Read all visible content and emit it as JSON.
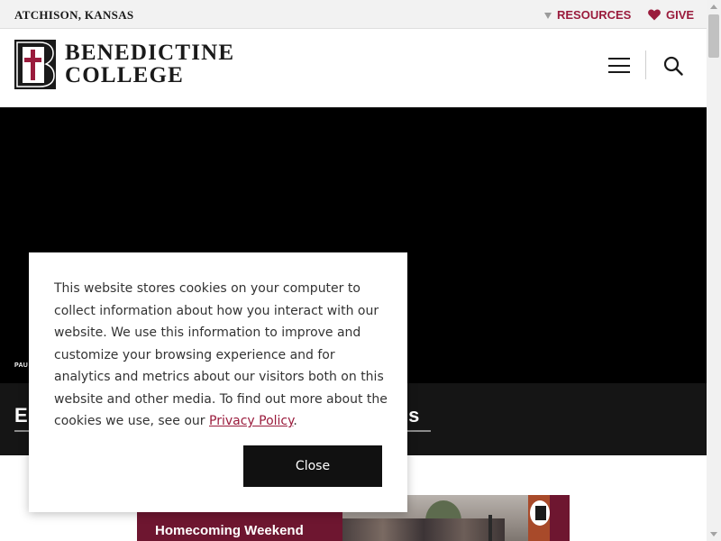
{
  "topbar": {
    "location": "ATCHISON, KANSAS",
    "resources_label": "RESOURCES",
    "give_label": "GIVE"
  },
  "header": {
    "logo_line1": "BENEDICTINE",
    "logo_line2": "COLLEGE"
  },
  "hero": {
    "caption": "PAU",
    "headline_start": "E",
    "headline_end": "us"
  },
  "promo": {
    "title": "Homecoming Weekend"
  },
  "cookie": {
    "text_before_link": "This website stores cookies on your computer to collect information about how you interact with our website. We use this information to improve and customize your browsing experience and for analytics and metrics about our visitors both on this website and other media. To find out more about the cookies we use, see our ",
    "link_text": "Privacy Policy",
    "text_after_link": ".",
    "close_label": "Close"
  },
  "colors": {
    "brand": "#9a1b3c",
    "hero_bg": "#000000",
    "band_bg": "#151515",
    "promo_bg": "#6e1630",
    "button_bg": "#111111"
  },
  "icons": {
    "resources": "triangle-down-icon",
    "give": "heart-icon",
    "menu": "hamburger-icon",
    "search": "search-icon",
    "logo": "benedictine-b-cross-logo"
  }
}
